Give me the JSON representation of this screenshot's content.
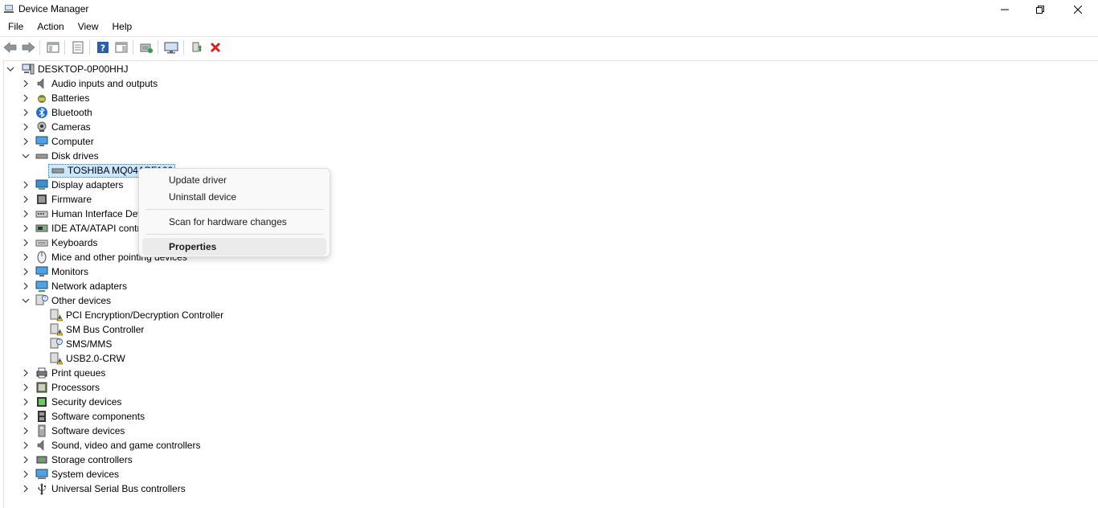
{
  "window": {
    "title": "Device Manager"
  },
  "menu": [
    "File",
    "Action",
    "View",
    "Help"
  ],
  "toolbar": {
    "buttons": [
      "back-icon",
      "forward-icon",
      "show-hide-console-tree-icon",
      "properties-icon",
      "help-icon",
      "action-pane-icon",
      "update-driver-icon",
      "scan-hardware-icon",
      "enable-device-icon",
      "uninstall-device-icon"
    ]
  },
  "tree": {
    "root": "DESKTOP-0P00HHJ",
    "categories": [
      {
        "label": "Audio inputs and outputs",
        "expanded": false
      },
      {
        "label": "Batteries",
        "expanded": false
      },
      {
        "label": "Bluetooth",
        "expanded": false
      },
      {
        "label": "Cameras",
        "expanded": false
      },
      {
        "label": "Computer",
        "expanded": false
      },
      {
        "label": "Disk drives",
        "expanded": true
      },
      {
        "label": "Display adapters",
        "expanded": false
      },
      {
        "label": "Firmware",
        "expanded": false
      },
      {
        "label": "Human Interface Dev",
        "expanded": false
      },
      {
        "label": "IDE ATA/ATAPI contr",
        "expanded": false
      },
      {
        "label": "Keyboards",
        "expanded": false
      },
      {
        "label": "Mice and other pointing devices",
        "expanded": false
      },
      {
        "label": "Monitors",
        "expanded": false
      },
      {
        "label": "Network adapters",
        "expanded": false
      },
      {
        "label": "Other devices",
        "expanded": true
      },
      {
        "label": "Print queues",
        "expanded": false
      },
      {
        "label": "Processors",
        "expanded": false
      },
      {
        "label": "Security devices",
        "expanded": false
      },
      {
        "label": "Software components",
        "expanded": false
      },
      {
        "label": "Software devices",
        "expanded": false
      },
      {
        "label": "Sound, video and game controllers",
        "expanded": false
      },
      {
        "label": "Storage controllers",
        "expanded": false
      },
      {
        "label": "System devices",
        "expanded": false
      },
      {
        "label": "Universal Serial Bus controllers",
        "expanded": false
      }
    ],
    "disk_drives": [
      "TOSHIBA MQ04ABF100"
    ],
    "other_devices": [
      "PCI Encryption/Decryption Controller",
      "SM Bus Controller",
      "SMS/MMS",
      "USB2.0-CRW"
    ]
  },
  "context_menu": {
    "items": [
      "Update driver",
      "Uninstall device",
      "Scan for hardware changes",
      "Properties"
    ]
  }
}
